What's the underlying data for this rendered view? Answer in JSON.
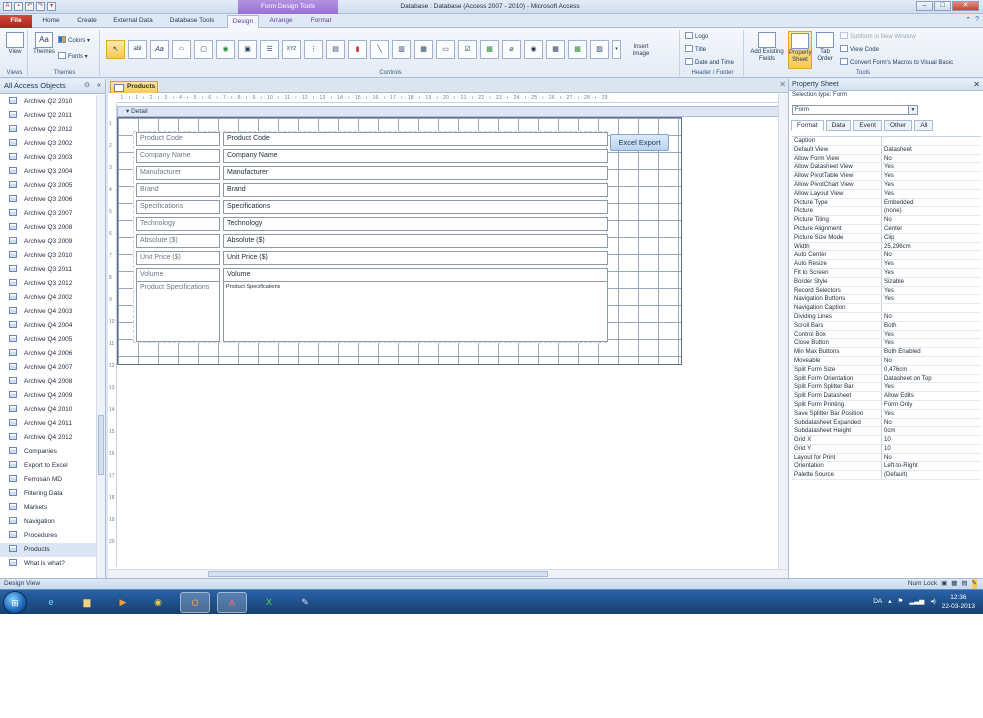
{
  "window": {
    "title": "Database : Database (Access 2007 - 2010) - Microsoft Access",
    "context_tab_title": "Form Design Tools"
  },
  "ribbon_tabs": [
    "File",
    "Home",
    "Create",
    "External Data",
    "Database Tools",
    "Design",
    "Arrange",
    "Format"
  ],
  "groups": {
    "views": {
      "label": "Views",
      "view": "View"
    },
    "themes": {
      "label": "Themes",
      "themes": "Themes",
      "colors": "Colors",
      "fonts": "Fonts"
    },
    "controls": {
      "label": "Controls",
      "insert_image": "Insert Image",
      "xyz": "XYZ"
    },
    "header_footer": {
      "label": "Header / Footer",
      "logo": "Logo",
      "title": "Title",
      "date_time": "Date and Time"
    },
    "tools": {
      "label": "Tools",
      "add_existing": "Add Existing Fields",
      "property_sheet": "Property Sheet",
      "tab_order": "Tab Order",
      "subform": "Subform in New Window",
      "view_code": "View Code",
      "convert_macros": "Convert Form's Macros to Visual Basic"
    }
  },
  "navpane": {
    "header": "All Access Objects",
    "items": [
      "Archive Q2 2010",
      "Archive Q2 2011",
      "Archive Q2 2012",
      "Archive Q3 2002",
      "Archive Q3 2003",
      "Archive Q3 2004",
      "Archive Q3 2005",
      "Archive Q3 2006",
      "Archive Q3 2007",
      "Archive Q3 2008",
      "Archive Q3 2009",
      "Archive Q3 2010",
      "Archive Q3 2011",
      "Archive Q3 2012",
      "Archive Q4 2002",
      "Archive Q4 2003",
      "Archive Q4 2004",
      "Archive Q4 2005",
      "Archive Q4 2006",
      "Archive Q4 2007",
      "Archive Q4 2008",
      "Archive Q4 2009",
      "Archive Q4 2010",
      "Archive Q4 2011",
      "Archive Q4 2012",
      "Companies",
      "Export to Excel",
      "Ferrosan MD",
      "Filtering Data",
      "Markets",
      "Navigation",
      "Procedures",
      "Products",
      "What is what?"
    ],
    "selected": "Products"
  },
  "document": {
    "tab": "Products",
    "section": "Detail",
    "rows": [
      {
        "label": "Product Code",
        "field": "Product Code"
      },
      {
        "label": "Company Name",
        "field": "Company Name"
      },
      {
        "label": "Manufacturer",
        "field": "Manufacturer"
      },
      {
        "label": "Brand",
        "field": "Brand"
      },
      {
        "label": "Specifications",
        "field": "Specifications"
      },
      {
        "label": "Technology",
        "field": "Technology"
      },
      {
        "label": "Absolute ($)",
        "field": "Absolute ($)"
      },
      {
        "label": "Unit Price ($)",
        "field": "Unit Price ($)"
      },
      {
        "label": "Volume",
        "field": "Volume"
      }
    ],
    "memo_label": "Product Specifications",
    "memo_field": "Product Specifications",
    "button": "Excel Export",
    "ruler_text": "· 1 · ı · 1 · ı · 2 · ı · 3 · ı · 4 · ı · 5 · ı · 6 · ı · 7 · ı · 8 · ı · 9 · ı · 10 · ı · 11 · ı · 12 · ı · 13 · ı · 14 · ı · 15 · ı · 16 · ı · 17 · ı · 18 · ı · 19 · ı · 20 · ı · 21 · ı · 22 · ı · 23 · ı · 24 · ı · 25 · ı · 26 · ı · 27 · ı · 28 · ı · 29 ·",
    "vruler": [
      "1",
      "2",
      "3",
      "4",
      "5",
      "6",
      "7",
      "8",
      "9",
      "10",
      "11",
      "12",
      "13",
      "14",
      "15",
      "16",
      "17",
      "18",
      "19",
      "20"
    ]
  },
  "propsheet": {
    "title": "Property Sheet",
    "selection_type": "Selection type:  Form",
    "object": "Form",
    "tabs": [
      "Format",
      "Data",
      "Event",
      "Other",
      "All"
    ],
    "properties": [
      [
        "Caption",
        ""
      ],
      [
        "Default View",
        "Datasheet"
      ],
      [
        "Allow Form View",
        "No"
      ],
      [
        "Allow Datasheet View",
        "Yes"
      ],
      [
        "Allow PivotTable View",
        "Yes"
      ],
      [
        "Allow PivotChart View",
        "Yes"
      ],
      [
        "Allow Layout View",
        "Yes"
      ],
      [
        "Picture Type",
        "Embedded"
      ],
      [
        "Picture",
        "(none)"
      ],
      [
        "Picture Tiling",
        "No"
      ],
      [
        "Picture Alignment",
        "Center"
      ],
      [
        "Picture Size Mode",
        "Clip"
      ],
      [
        "Width",
        "25,296cm"
      ],
      [
        "Auto Center",
        "No"
      ],
      [
        "Auto Resize",
        "Yes"
      ],
      [
        "Fit to Screen",
        "Yes"
      ],
      [
        "Border Style",
        "Sizable"
      ],
      [
        "Record Selectors",
        "Yes"
      ],
      [
        "Navigation Buttons",
        "Yes"
      ],
      [
        "Navigation Caption",
        ""
      ],
      [
        "Dividing Lines",
        "No"
      ],
      [
        "Scroll Bars",
        "Both"
      ],
      [
        "Control Box",
        "Yes"
      ],
      [
        "Close Button",
        "Yes"
      ],
      [
        "Min Max Buttons",
        "Both Enabled"
      ],
      [
        "Moveable",
        "No"
      ],
      [
        "Split Form Size",
        "0,476cm"
      ],
      [
        "Split Form Orientation",
        "Datasheet on Top"
      ],
      [
        "Split Form Splitter Bar",
        "Yes"
      ],
      [
        "Split Form Datasheet",
        "Allow Edits"
      ],
      [
        "Split Form Printing",
        "Form Only"
      ],
      [
        "Save Splitter Bar Position",
        "Yes"
      ],
      [
        "Subdatasheet Expanded",
        "No"
      ],
      [
        "Subdatasheet Height",
        "0cm"
      ],
      [
        "Grid X",
        "10"
      ],
      [
        "Grid Y",
        "10"
      ],
      [
        "Layout for Print",
        "No"
      ],
      [
        "Orientation",
        "Left-to-Right"
      ],
      [
        "Palette Source",
        "(Default)"
      ]
    ]
  },
  "statusbar": {
    "left": "Design View",
    "numlock": "Num Lock"
  },
  "taskbar": {
    "lang": "DA",
    "time": "12:36",
    "date": "22-03-2013"
  }
}
